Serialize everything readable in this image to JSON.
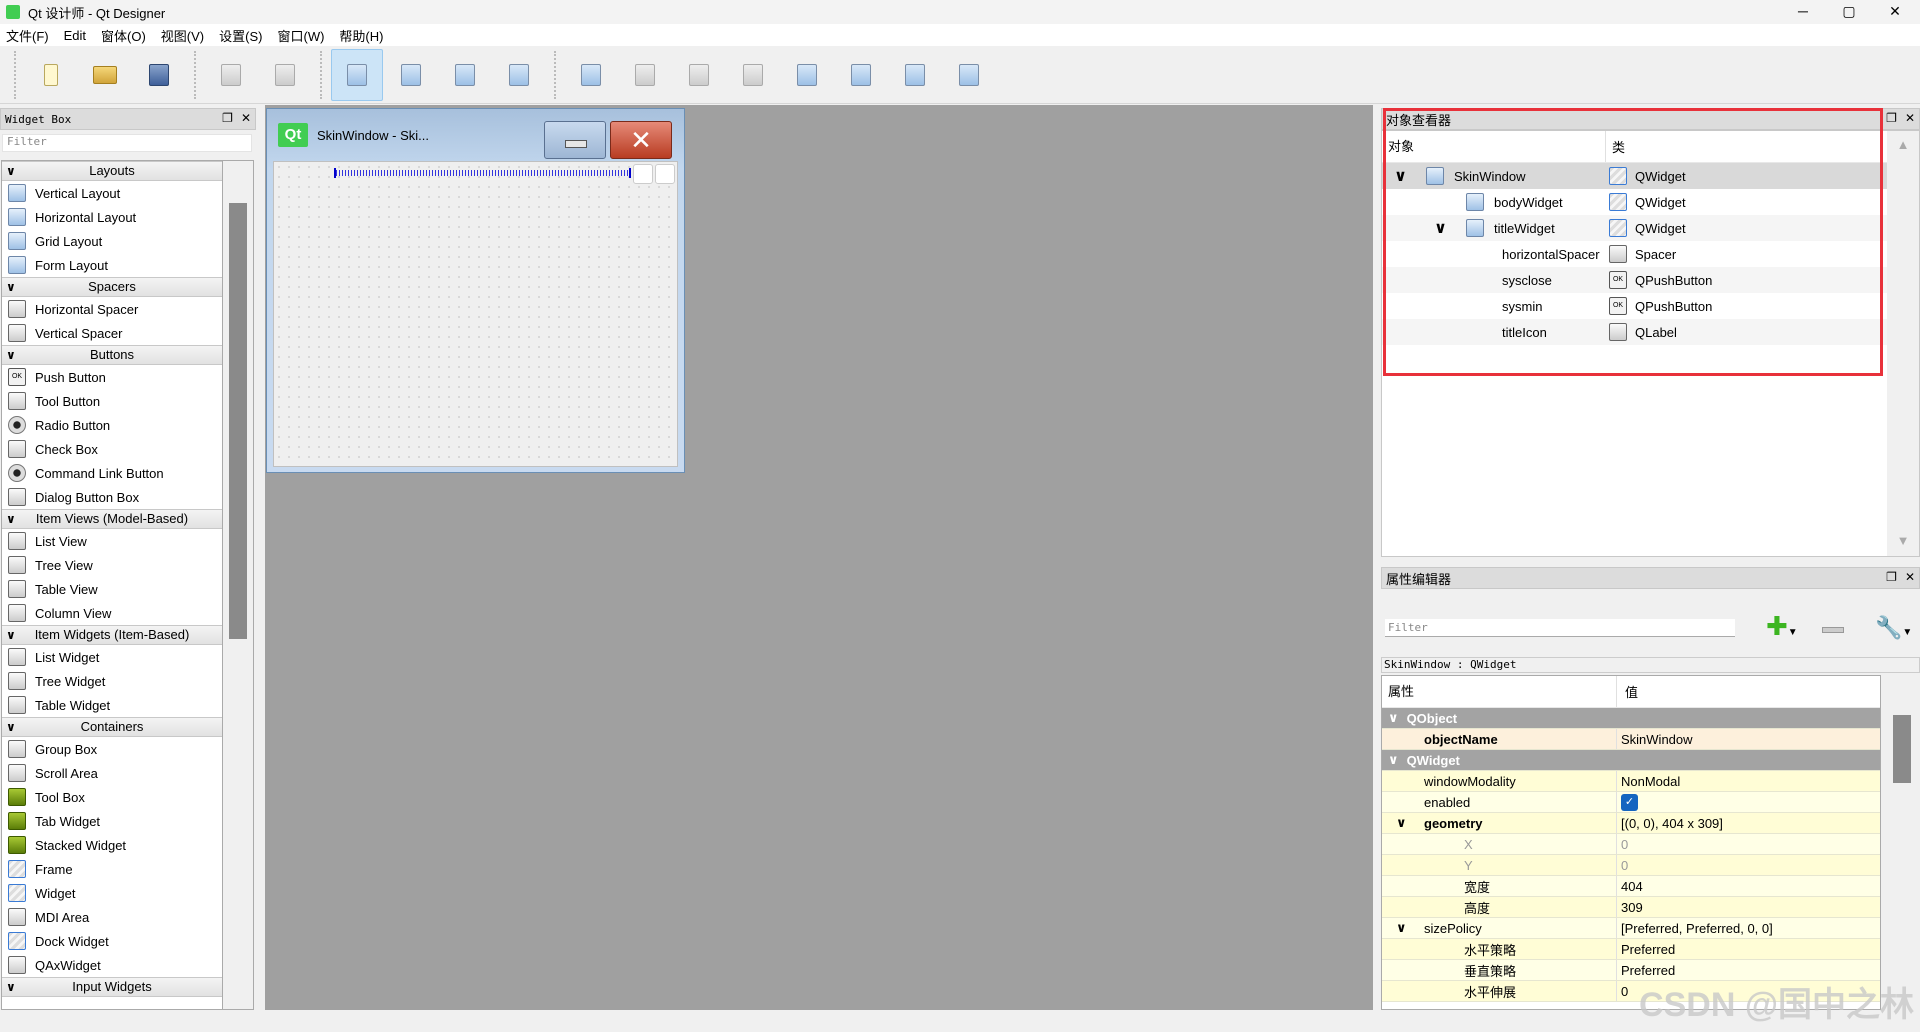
{
  "window": {
    "title": "Qt 设计师 - Qt Designer",
    "minimize": "─",
    "maximize": "▢",
    "close": "✕"
  },
  "menu": [
    "文件(F)",
    "Edit",
    "窗体(O)",
    "视图(V)",
    "设置(S)",
    "窗口(W)",
    "帮助(H)"
  ],
  "toolbar": {
    "groups": [
      [
        "new",
        "open",
        "save"
      ],
      [
        "cut-copy",
        "paste"
      ],
      [
        "edit-widgets",
        "edit-signals-slots",
        "edit-buddies",
        "edit-tab-order"
      ],
      [
        "layout-horizontal",
        "layout-vertical",
        "layout-splitter-horizontal",
        "layout-splitter-vertical",
        "layout-grid",
        "layout-form",
        "break-layout",
        "adjust-size"
      ]
    ],
    "active": "edit-widgets"
  },
  "widget_box": {
    "title": "Widget Box",
    "filter_placeholder": "Filter",
    "categories": [
      {
        "label": "Layouts",
        "items": [
          {
            "label": "Vertical Layout",
            "icon": "vertical-layout"
          },
          {
            "label": "Horizontal Layout",
            "icon": "horizontal-layout"
          },
          {
            "label": "Grid Layout",
            "icon": "grid-layout"
          },
          {
            "label": "Form Layout",
            "icon": "form-layout"
          }
        ]
      },
      {
        "label": "Spacers",
        "items": [
          {
            "label": "Horizontal Spacer",
            "icon": "horizontal-spacer"
          },
          {
            "label": "Vertical Spacer",
            "icon": "vertical-spacer"
          }
        ]
      },
      {
        "label": "Buttons",
        "items": [
          {
            "label": "Push Button",
            "icon": "push-button"
          },
          {
            "label": "Tool Button",
            "icon": "tool-button"
          },
          {
            "label": "Radio Button",
            "icon": "radio-button"
          },
          {
            "label": "Check Box",
            "icon": "check-box"
          },
          {
            "label": "Command Link Button",
            "icon": "command-link"
          },
          {
            "label": "Dialog Button Box",
            "icon": "dialog-button-box"
          }
        ]
      },
      {
        "label": "Item Views (Model-Based)",
        "items": [
          {
            "label": "List View",
            "icon": "list-view"
          },
          {
            "label": "Tree View",
            "icon": "tree-view"
          },
          {
            "label": "Table View",
            "icon": "table-view"
          },
          {
            "label": "Column View",
            "icon": "column-view"
          }
        ]
      },
      {
        "label": "Item Widgets (Item-Based)",
        "items": [
          {
            "label": "List Widget",
            "icon": "list-widget"
          },
          {
            "label": "Tree Widget",
            "icon": "tree-widget"
          },
          {
            "label": "Table Widget",
            "icon": "table-widget"
          }
        ]
      },
      {
        "label": "Containers",
        "items": [
          {
            "label": "Group Box",
            "icon": "group-box"
          },
          {
            "label": "Scroll Area",
            "icon": "scroll-area"
          },
          {
            "label": "Tool Box",
            "icon": "tool-box"
          },
          {
            "label": "Tab Widget",
            "icon": "tab-widget"
          },
          {
            "label": "Stacked Widget",
            "icon": "stacked-widget"
          },
          {
            "label": "Frame",
            "icon": "frame"
          },
          {
            "label": "Widget",
            "icon": "widget"
          },
          {
            "label": "MDI Area",
            "icon": "mdi-area"
          },
          {
            "label": "Dock Widget",
            "icon": "dock-widget"
          },
          {
            "label": "QAxWidget",
            "icon": "qaxwidget"
          }
        ]
      },
      {
        "label": "Input Widgets",
        "items": []
      }
    ]
  },
  "form": {
    "title": "SkinWindow - Ski...",
    "logo": "Qt",
    "close_glyph": "✕"
  },
  "object_inspector": {
    "title": "对象查看器",
    "col_object": "对象",
    "col_class": "类",
    "rows": [
      {
        "name": "SkinWindow",
        "class": "QWidget",
        "depth": 0,
        "expanded": true,
        "icon": "vertical-layout",
        "selected": true
      },
      {
        "name": "bodyWidget",
        "class": "QWidget",
        "depth": 1,
        "expanded": null,
        "icon": "grid-layout"
      },
      {
        "name": "titleWidget",
        "class": "QWidget",
        "depth": 1,
        "expanded": true,
        "icon": "horizontal-layout"
      },
      {
        "name": "horizontalSpacer",
        "class": "Spacer",
        "depth": 2,
        "expanded": null,
        "icon": null
      },
      {
        "name": "sysclose",
        "class": "QPushButton",
        "depth": 2,
        "expanded": null,
        "icon": null
      },
      {
        "name": "sysmin",
        "class": "QPushButton",
        "depth": 2,
        "expanded": null,
        "icon": null
      },
      {
        "name": "titleIcon",
        "class": "QLabel",
        "depth": 2,
        "expanded": null,
        "icon": null
      }
    ],
    "highlight_color": "#e8313a"
  },
  "property_editor": {
    "title": "属性编辑器",
    "filter_placeholder": "Filter",
    "context": "SkinWindow : QWidget",
    "col_property": "属性",
    "col_value": "值",
    "rows": [
      {
        "type": "group",
        "name": "QObject"
      },
      {
        "name": "objectName",
        "value": "SkinWindow",
        "bold": true,
        "depth": 0,
        "bg": "#fdf0dc"
      },
      {
        "type": "group",
        "name": "QWidget"
      },
      {
        "name": "windowModality",
        "value": "NonModal",
        "depth": 0
      },
      {
        "name": "enabled",
        "value": "",
        "checkbox": true,
        "checked": true,
        "depth": 0
      },
      {
        "name": "geometry",
        "value": "[(0, 0), 404 x 309]",
        "bold": true,
        "expand": true,
        "depth": 0
      },
      {
        "name": "X",
        "value": "0",
        "depth": 1,
        "dim": true
      },
      {
        "name": "Y",
        "value": "0",
        "depth": 1,
        "dim": true
      },
      {
        "name": "宽度",
        "value": "404",
        "depth": 1
      },
      {
        "name": "高度",
        "value": "309",
        "depth": 1
      },
      {
        "name": "sizePolicy",
        "value": "[Preferred, Preferred, 0, 0]",
        "expand": true,
        "depth": 0
      },
      {
        "name": "水平策略",
        "value": "Preferred",
        "depth": 1
      },
      {
        "name": "垂直策略",
        "value": "Preferred",
        "depth": 1
      },
      {
        "name": "水平伸展",
        "value": "0",
        "depth": 1
      }
    ]
  },
  "watermark": "CSDN @国中之林"
}
